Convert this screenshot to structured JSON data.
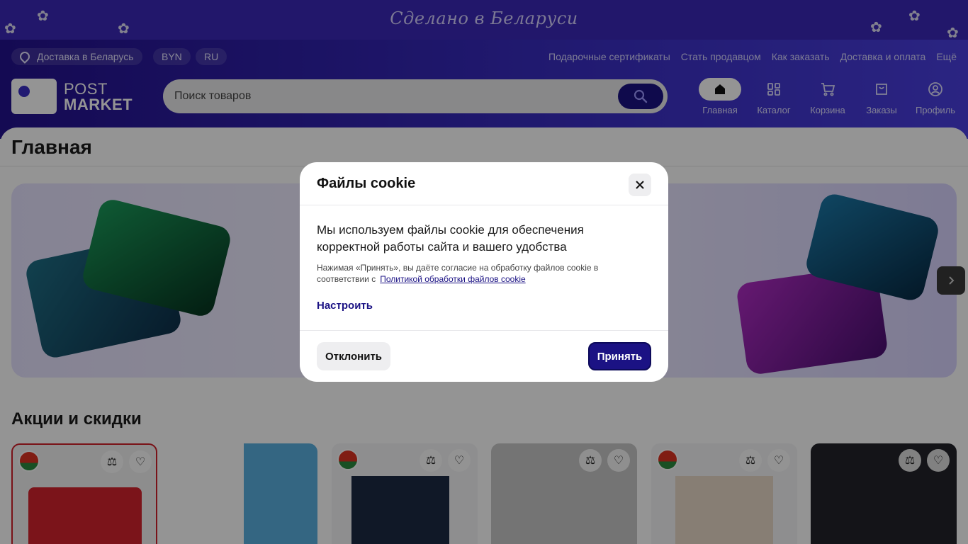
{
  "promo": {
    "text": "Сделано в Беларуси"
  },
  "topbar": {
    "delivery": "Доставка в Беларусь",
    "currency": "BYN",
    "language": "RU",
    "links": [
      "Подарочные сертификаты",
      "Стать продавцом",
      "Как заказать",
      "Доставка и оплата",
      "Ещё"
    ]
  },
  "logo": {
    "line1": "POST",
    "line2": "MARKET"
  },
  "search": {
    "placeholder": "Поиск товаров"
  },
  "nav": [
    {
      "label": "Главная",
      "icon": "home-icon",
      "active": true
    },
    {
      "label": "Каталог",
      "icon": "catalog-icon"
    },
    {
      "label": "Корзина",
      "icon": "cart-icon"
    },
    {
      "label": "Заказы",
      "icon": "orders-icon"
    },
    {
      "label": "Профиль",
      "icon": "profile-icon"
    }
  ],
  "page": {
    "title": "Главная",
    "section_title": "Акции и скидки"
  },
  "cookie_modal": {
    "title": "Файлы cookie",
    "body": "Мы используем файлы cookie для обеспечения корректной работы сайта и вашего удобства",
    "note": "Нажимая «Принять», вы даёте согласие на обработку файлов cookie в соответствии с",
    "policy_link": "Политикой обработки файлов cookie",
    "configure": "Настроить",
    "decline": "Отклонить",
    "accept": "Принять"
  },
  "colors": {
    "brand": "#1b1284",
    "header": "#3a2ec4"
  }
}
